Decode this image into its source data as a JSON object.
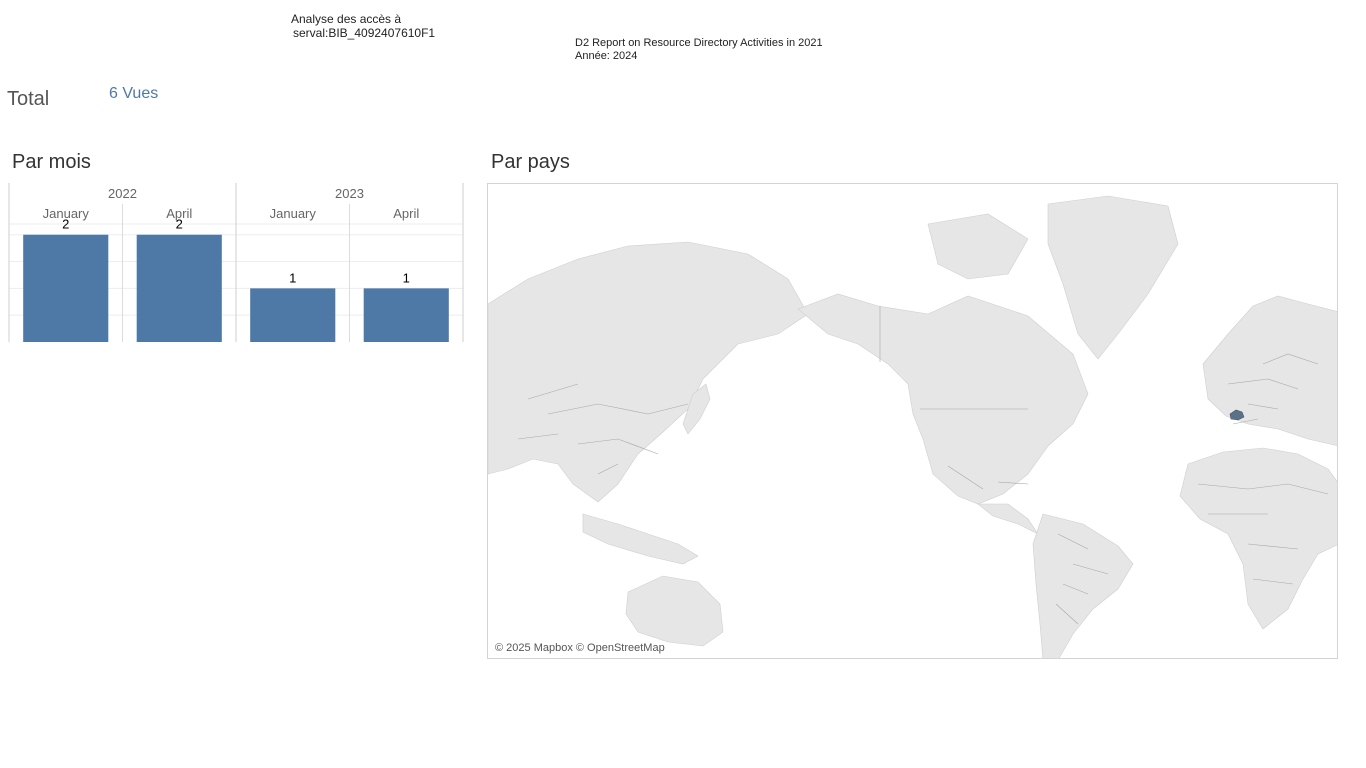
{
  "header": {
    "title_line1": "Analyse des accès à",
    "title_line2": "serval:BIB_4092407610F1"
  },
  "report": {
    "name": "D2 Report on Resource Directory Activities in 2021",
    "year": "Année: 2024"
  },
  "total": {
    "label": "Total",
    "value": "6 Vues"
  },
  "sections": {
    "by_month": "Par mois",
    "by_country": "Par pays"
  },
  "chart_data": {
    "type": "bar",
    "groups": [
      {
        "year": "2022",
        "months": [
          "January",
          "April"
        ]
      },
      {
        "year": "2023",
        "months": [
          "January",
          "April"
        ]
      }
    ],
    "categories": [
      "January",
      "April",
      "January",
      "April"
    ],
    "values": [
      2,
      2,
      1,
      1
    ],
    "ylim": [
      0,
      2.2
    ],
    "grid": true,
    "color": "#4e79a7"
  },
  "map": {
    "attribution": "© 2025 Mapbox © OpenStreetMap",
    "highlight_color": "#5b7189"
  }
}
